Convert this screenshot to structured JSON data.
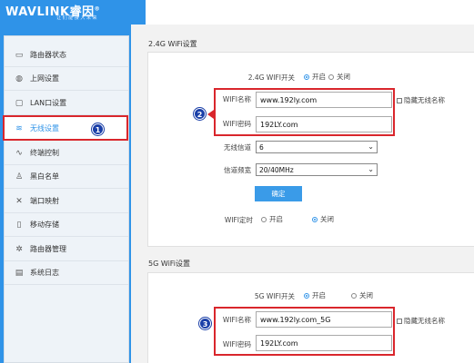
{
  "header": {
    "brand": "WAVLINK睿因",
    "tagline": "让 们 能 接 入 未 来",
    "registered": "®"
  },
  "sidebar": {
    "items": [
      {
        "label": "路由器状态",
        "icon": "router-status-icon"
      },
      {
        "label": "上网设置",
        "icon": "globe-icon"
      },
      {
        "label": "LAN口设置",
        "icon": "lan-icon"
      },
      {
        "label": "无线设置",
        "icon": "wifi-icon",
        "active": true
      },
      {
        "label": "终端控制",
        "icon": "terminal-control-icon"
      },
      {
        "label": "黑白名单",
        "icon": "user-icon"
      },
      {
        "label": "端口映射",
        "icon": "tools-icon"
      },
      {
        "label": "移动存储",
        "icon": "storage-icon"
      },
      {
        "label": "路由器管理",
        "icon": "gear-icon"
      },
      {
        "label": "系统日志",
        "icon": "log-icon"
      }
    ]
  },
  "wifi24": {
    "section_title": "2.4G WiFi设置",
    "switch_label": "2.4G WIFI开关",
    "on_label": "开启",
    "off_label": "关闭",
    "switch_value": "开启",
    "name_label": "WIFI名称",
    "name_value": "www.192ly.com",
    "hide_label": "隐藏无线名称",
    "password_label": "WIFI密码",
    "password_value": "192LY.com",
    "channel_label": "无线信道",
    "channel_value": "6",
    "bandwidth_label": "信道频宽",
    "bandwidth_value": "20/40MHz",
    "confirm_label": "确定",
    "timer_label": "WIFI定时",
    "timer_on_label": "开启",
    "timer_off_label": "关闭",
    "timer_value": "关闭"
  },
  "wifi5": {
    "section_title": "5G WiFi设置",
    "switch_label": "5G WIFI开关",
    "on_label": "开启",
    "off_label": "关闭",
    "switch_value": "开启",
    "name_label": "WIFI名称",
    "name_value": "www.192ly.com_5G",
    "hide_label": "隐藏无线名称",
    "password_label": "WIFI密码",
    "password_value": "192LY.com"
  },
  "annotations": {
    "step1": "1",
    "step2": "2",
    "step3": "3"
  },
  "colors": {
    "brand_blue": "#2f93e8",
    "highlight_red": "#d9262c",
    "badge_navy": "#1a3fa8"
  }
}
